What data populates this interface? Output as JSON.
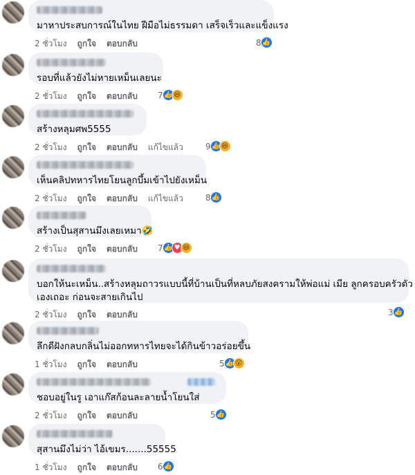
{
  "comments": [
    {
      "text": "มาหาประสบการณ์ในไทย ฝีมือไม่ธรรมดา เสร็จเร็วและแข็งแรง",
      "time": "2 ชั่วโมง",
      "like": "ถูกใจ",
      "reply": "ตอบกลับ",
      "reaction_count": "8",
      "reactions": [
        "like"
      ]
    },
    {
      "text": "รอบที่แล้วยังไม่หายเหม็นเลยนะ",
      "time": "2 ชั่วโมง",
      "like": "ถูกใจ",
      "reply": "ตอบกลับ",
      "reaction_count": "7",
      "reactions": [
        "like",
        "haha"
      ]
    },
    {
      "text": "สร้างหลุมศพ5555",
      "time": "2 ชั่วโมง",
      "like": "ถูกใจ",
      "reply": "ตอบกลับ",
      "edited": "แก้ไขแล้ว",
      "reaction_count": "9",
      "reactions": [
        "like",
        "haha"
      ]
    },
    {
      "text": "เห็นคลิปทหารไทยโยนลูกบึ้มเข้าไปยังเหม็น",
      "time": "2 ชั่วโมง",
      "like": "ถูกใจ",
      "reply": "ตอบกลับ",
      "edited": "แก้ไขแล้ว",
      "reaction_count": "8",
      "reactions": [
        "like"
      ]
    },
    {
      "text": "สร้างเป็นสุสานมึงเลยเหมา🤣",
      "time": "2 ชั่วโมง",
      "like": "ถูกใจ",
      "reply": "ตอบกลับ",
      "reaction_count": "7",
      "reactions": [
        "like",
        "love",
        "haha"
      ]
    },
    {
      "text_line1": "บอกให้นะเหม็น..สร้างหลุมถาวรแบบนี้ที่บ้านเป็นที่หลบภัยสงครามให้พ่อแม่ เมีย ลูกครอบครัวตัว",
      "text_line2": "เองเถอะ ก่อนจะสายเกินไป",
      "time": "2 ชั่วโมง",
      "like": "ถูกใจ",
      "reply": "ตอบกลับ",
      "reaction_count": "3",
      "reactions": [
        "like"
      ]
    },
    {
      "text": "ลึกดีฝังกลบกลิ่นไม่ออกทหารไทยจะได้กินข้าวอร่อยขึ้น",
      "time": "1 ชั่วโมง",
      "like": "ถูกใจ",
      "reply": "ตอบกลับ",
      "reaction_count": "5",
      "reactions": [
        "like",
        "wow"
      ]
    },
    {
      "text": "ชอบอยู่ในรู เอาแก๊สก้อนละลายน้ำโยนใส่",
      "time": "2 ชั่วโมง",
      "like": "ถูกใจ",
      "reply": "ตอบกลับ",
      "reaction_count": "5",
      "reactions": [
        "like"
      ]
    },
    {
      "text": "สุสานมึงไม่ว่า ไอ้เขมร.......55555",
      "time": "1 ชั่วโมง",
      "like": "ถูกใจ",
      "reply": "ตอบกลับ",
      "reaction_count": "6",
      "reactions": [
        "like"
      ]
    }
  ],
  "icons": {
    "like": "thumbs-up-icon",
    "love": "heart-icon",
    "haha": "laughing-face-icon",
    "wow": "surprised-face-icon"
  },
  "colors": {
    "bubble": "#f0f2f5",
    "meta": "#65676b",
    "like_blue": "#1877f2"
  }
}
